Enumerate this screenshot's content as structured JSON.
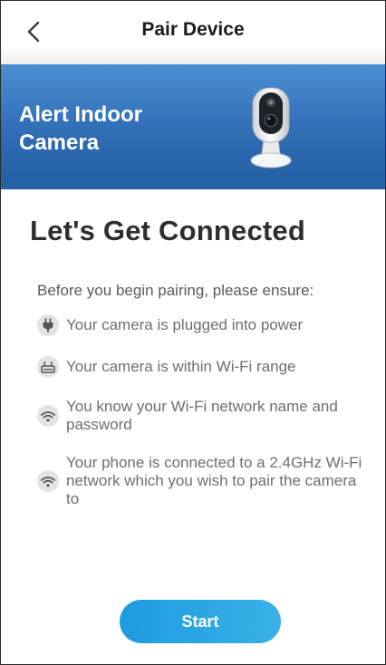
{
  "header": {
    "title": "Pair Device",
    "back_icon": "chevron-left-icon"
  },
  "banner": {
    "title": "Alert Indoor Camera",
    "image": "indoor-camera-illustration"
  },
  "content": {
    "heading": "Let's Get Connected",
    "intro": "Before you begin pairing, please ensure:",
    "checklist": [
      {
        "icon": "plug-icon",
        "text": "Your camera is plugged into power"
      },
      {
        "icon": "router-icon",
        "text": "Your camera is within Wi-Fi range"
      },
      {
        "icon": "wifi-icon",
        "text": "You know your Wi-Fi network name and password"
      },
      {
        "icon": "wifi-icon",
        "text": "Your phone is connected to a 2.4GHz Wi-Fi network which you wish to pair the camera to"
      }
    ]
  },
  "actions": {
    "start_label": "Start"
  },
  "colors": {
    "banner_top": "#4a8fd3",
    "banner_bottom": "#245ea3",
    "button_start": "#1e9be0",
    "button_end": "#3ab1e6"
  }
}
